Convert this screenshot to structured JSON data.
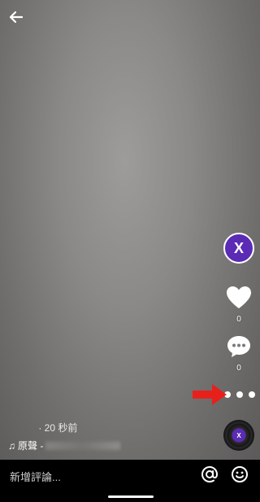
{
  "header": {
    "back_icon": "arrow-left-icon"
  },
  "sidebar": {
    "avatar_letter": "X",
    "like_count": "0",
    "comment_count": "0",
    "more_icon": "more-dots-icon",
    "disc_letter": "X"
  },
  "annotation": {
    "arrow_icon": "red-arrow-icon",
    "color": "#e8201b"
  },
  "info": {
    "time_text": "· 20 秒前",
    "music_note": "♫",
    "sound_label": "原聲 -"
  },
  "bottom": {
    "comment_placeholder": "新增評論...",
    "mention_icon": "at-icon",
    "emoji_icon": "emoji-icon"
  },
  "colors": {
    "accent": "#5b2bb5",
    "background": "#000000"
  }
}
